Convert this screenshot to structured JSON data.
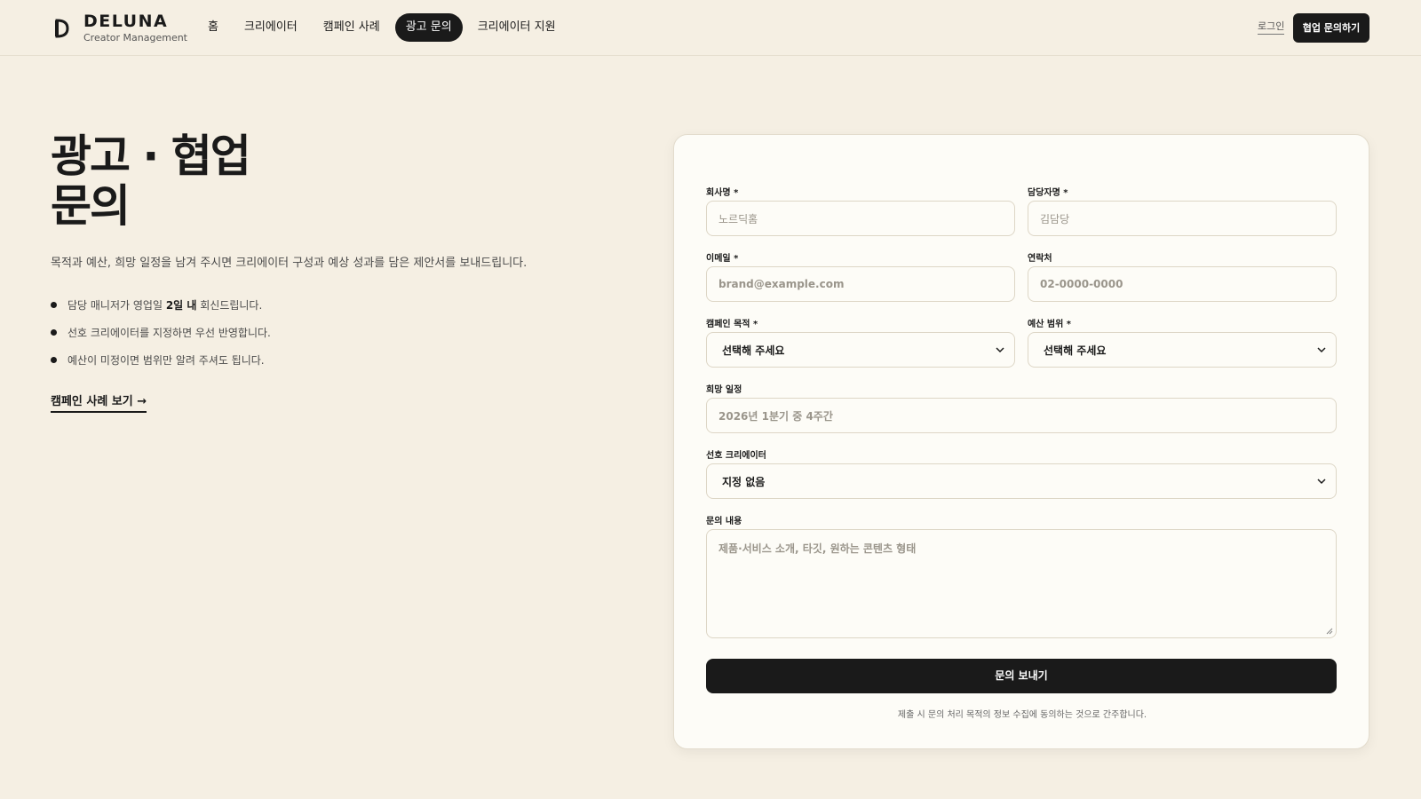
{
  "brand": {
    "name": "DELUNA",
    "tagline": "Creator Management"
  },
  "nav": {
    "items": [
      {
        "label": "홈",
        "active": false
      },
      {
        "label": "크리에이터",
        "active": false
      },
      {
        "label": "캠페인 사례",
        "active": false
      },
      {
        "label": "광고 문의",
        "active": true
      },
      {
        "label": "크리에이터 지원",
        "active": false
      }
    ],
    "login": "로그인",
    "cta": "협업 문의하기"
  },
  "hero": {
    "title_line1": "광고 · 협업",
    "title_line2": "문의",
    "description": "목적과 예산, 희망 일정을 남겨 주시면 크리에이터 구성과 예상 성과를 담은 제안서를 보내드립니다.",
    "bullet1_pre": "담당 매니저가 영업일 ",
    "bullet1_bold": "2일 내",
    "bullet1_post": " 회신드립니다.",
    "bullet2": "선호 크리에이터를 지정하면 우선 반영합니다.",
    "bullet3": "예산이 미정이면 범위만 알려 주셔도 됩니다.",
    "case_link": "캠페인 사례 보기 →"
  },
  "form": {
    "company": {
      "label": "회사명 *",
      "placeholder": "노르딕홈"
    },
    "manager": {
      "label": "담당자명 *",
      "placeholder": "김담당"
    },
    "email": {
      "label": "이메일 *",
      "placeholder": "brand@example.com"
    },
    "phone": {
      "label": "연락처",
      "placeholder": "02-0000-0000"
    },
    "purpose": {
      "label": "캠페인 목적 *",
      "value": "선택해 주세요"
    },
    "budget": {
      "label": "예산 범위 *",
      "value": "선택해 주세요"
    },
    "schedule": {
      "label": "희망 일정",
      "placeholder": "2026년 1분기 중 4주간"
    },
    "creator": {
      "label": "선호 크리에이터",
      "value": "지정 없음"
    },
    "message": {
      "label": "문의 내용",
      "placeholder": "제품·서비스 소개, 타깃, 원하는 콘텐츠 형태"
    },
    "submit": "문의 보내기",
    "consent": "제출 시 문의 처리 목적의 정보 수집에 동의하는 것으로 간주합니다."
  },
  "colors": {
    "background": "#f5efe3",
    "card": "#fdfcf7",
    "accent": "#1a1a1a"
  }
}
